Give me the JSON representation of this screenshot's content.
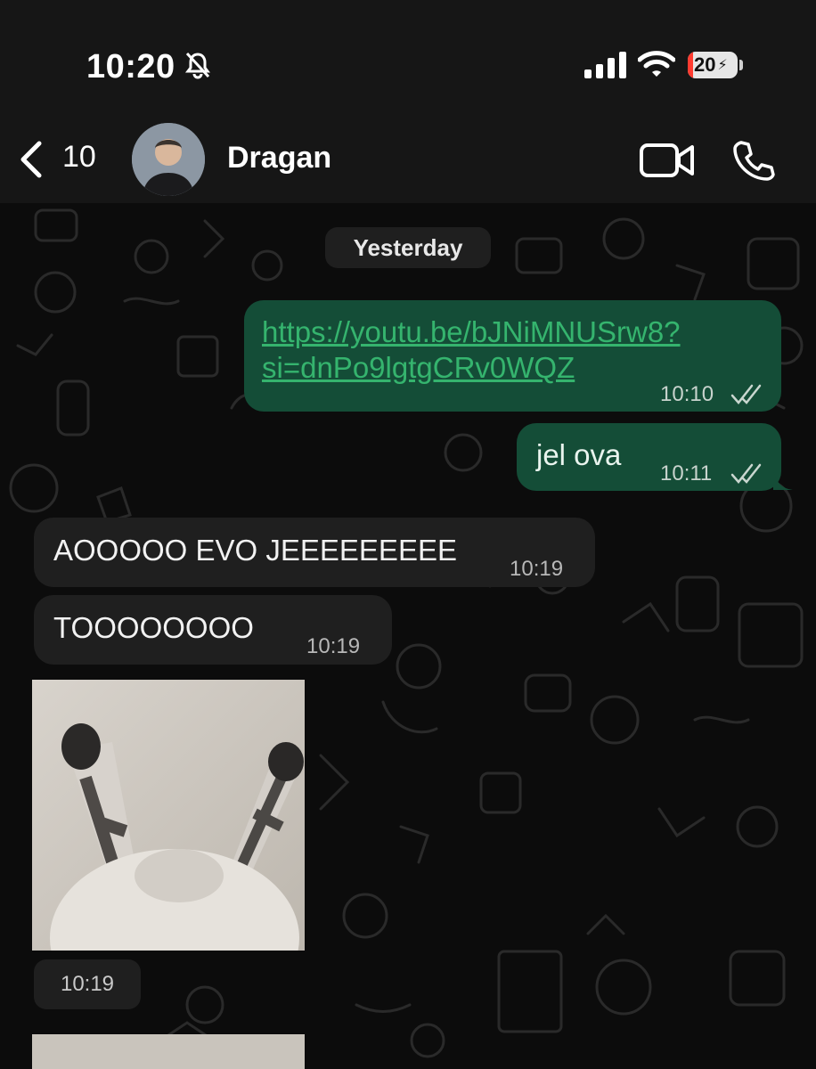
{
  "status_bar": {
    "time": "10:20",
    "battery": "20",
    "battery_level_percent": 20
  },
  "header": {
    "back_count": "10",
    "contact_name": "Dragan"
  },
  "date_divider": "Yesterday",
  "messages": [
    {
      "direction": "outgoing",
      "text_line1": "https://youtu.be/bJNiMNUSrw8?",
      "text_line2": "si=dnPo9lgtgCRv0WQZ",
      "time": "10:10",
      "read": true
    },
    {
      "direction": "outgoing",
      "text": "jel ova",
      "time": "10:11",
      "read": true
    },
    {
      "direction": "incoming",
      "text": "AOOOOO EVO JEEEEEEEEE",
      "time": "10:19"
    },
    {
      "direction": "incoming",
      "text": "TOOOOOOOO",
      "time": "10:19"
    },
    {
      "direction": "incoming",
      "type": "image",
      "time": "10:19"
    }
  ],
  "colors": {
    "outgoing_bubble": "#144d37",
    "incoming_bubble": "#1f1f1f",
    "link": "#35b46e"
  }
}
